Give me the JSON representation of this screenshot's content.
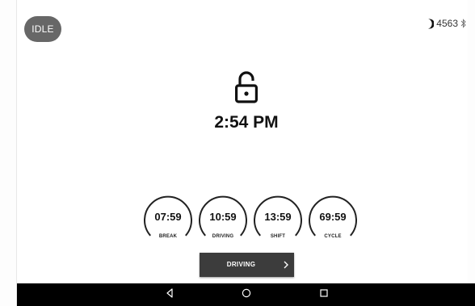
{
  "status": {
    "mode_label": "IDLE",
    "vehicle_number": "4563",
    "icons": [
      "moon-icon",
      "bluetooth-icon"
    ]
  },
  "lock": {
    "icon": "lock-open-icon"
  },
  "clock": {
    "time": "2:54 PM"
  },
  "gauges": [
    {
      "value": "07:59",
      "label": "BREAK",
      "fill": 0.82
    },
    {
      "value": "10:59",
      "label": "DRIVING",
      "fill": 0.82
    },
    {
      "value": "13:59",
      "label": "SHIFT",
      "fill": 0.82
    },
    {
      "value": "69:59",
      "label": "CYCLE",
      "fill": 0.82
    }
  ],
  "action_button": {
    "label": "DRIVING",
    "icon": "chevron-right-icon"
  },
  "nav": {
    "icons": [
      "back-icon",
      "home-icon",
      "recents-icon"
    ]
  },
  "colors": {
    "pill_bg": "#676767",
    "button_bg": "#3c3c3c",
    "nav_bg": "#000000",
    "gauge_stroke": "#222222"
  }
}
